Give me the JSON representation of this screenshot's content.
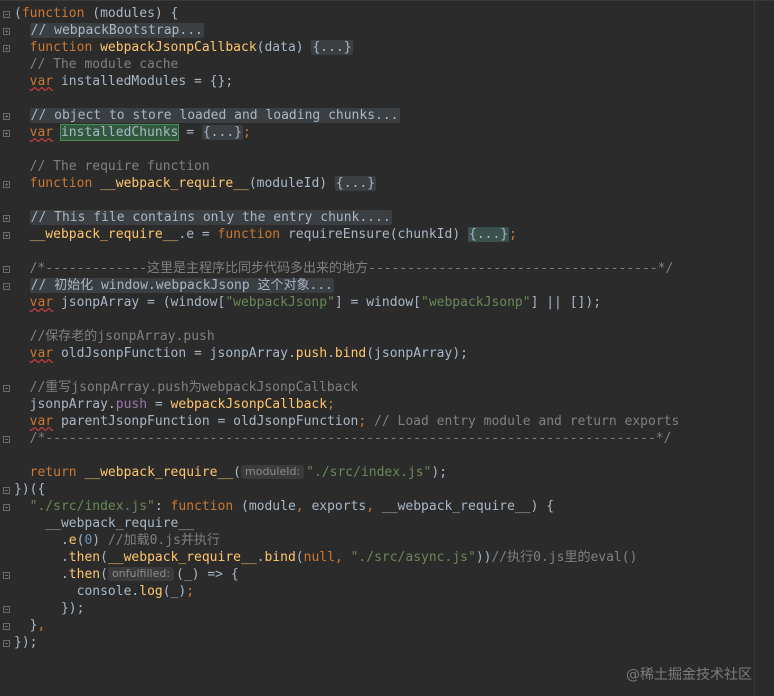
{
  "colors": {
    "background": "#2b2b2b",
    "keyword": "#cc7832",
    "function_name": "#ffc66d",
    "comment": "#808080",
    "string": "#6a8759",
    "number": "#6897bb",
    "property": "#9876aa",
    "plain": "#a9b7c6",
    "selection": "#32593d"
  },
  "editor": {
    "lines": {
      "l1": {
        "a": "(",
        "kw": "function",
        "b": " (modules) {"
      },
      "l2": {
        "comment": "// webpackBootstrap..."
      },
      "l3": {
        "kw": "function",
        "fn": "webpackJsonpCallback",
        "b": "(data) ",
        "fold": "{...}"
      },
      "l4": {
        "comment": "// The module cache"
      },
      "l5": {
        "kw": "var",
        "b": " installedModules = {};"
      },
      "l6": {},
      "l7": {
        "comment": "// object to store loaded and loading chunks..."
      },
      "l8": {
        "kw": "var",
        "sel": "installedChunks",
        "b": " = ",
        "fold": "{...}",
        "c": ";"
      },
      "l9": {},
      "l10": {
        "comment": "// The require function"
      },
      "l11": {
        "kw": "function",
        "fn": "__webpack_require__",
        "b": "(moduleId) ",
        "fold": "{...}"
      },
      "l12": {},
      "l13": {
        "comment": "// This file contains only the entry chunk...."
      },
      "l14": {
        "fn1": "__webpack_require__",
        "b": ".e = ",
        "kw": "function",
        "fn2": " requireEnsure",
        "c": "(chunkId) ",
        "fold": "{...}",
        "d": ";"
      },
      "l15": {},
      "l16": {
        "comment": "/*-------------这里是主程序比同步代码多出来的地方-------------------------------------*/"
      },
      "l17": {
        "comment": "// 初始化 window.webpackJsonp 这个对象..."
      },
      "l18": {
        "kw": "var",
        "b": " jsonpArray = (window[",
        "s1": "\"webpackJsonp\"",
        "c": "] = window[",
        "s2": "\"webpackJsonp\"",
        "d": "] || []);"
      },
      "l19": {},
      "l20": {
        "comment": "//保存老的jsonpArray.push"
      },
      "l21": {
        "kw": "var",
        "b": " oldJsonpFunction = jsonpArray.",
        "fn1": "push",
        "c": ".",
        "fn2": "bind",
        "d": "(jsonpArray);"
      },
      "l22": {},
      "l23": {
        "comment": "//重写jsonpArray.push为webpackJsonpCallback"
      },
      "l24": {
        "b": "jsonpArray.",
        "prop": "push",
        "c": " = ",
        "fn": "webpackJsonpCallback",
        "kw": ";"
      },
      "l25": {
        "kw": "var",
        "b": " parentJsonpFunction = oldJsonpFunction",
        "kw2": ";",
        "comment": " // Load entry module and return exports"
      },
      "l26": {
        "comment": "/*------------------------------------------------------------------------------*/"
      },
      "l27": {},
      "l28": {
        "kw": "return",
        "fn": " __webpack_require__",
        "b": "(",
        "hint": "moduleId:",
        "s": "\"./src/index.js\"",
        "c": ");"
      },
      "l29": {
        "a": "})({"
      },
      "l30": {
        "s": "\"./src/index.js\"",
        "b": ": ",
        "kw": "function",
        "c": " (module",
        "kw2": ",",
        "d": " exports",
        "kw3": ",",
        "e": " __webpack_require__) {"
      },
      "l31": {
        "b": "__webpack_require__"
      },
      "l32": {
        "b": ".",
        "fn": "e",
        "c": "(",
        "num": "0",
        "d": ") ",
        "comment": "//加载0.js并执行"
      },
      "l33": {
        "b": ".",
        "fn": "then",
        "c": "(",
        "fn2": "__webpack_require__",
        "d": ".",
        "fn3": "bind",
        "e": "(",
        "kw": "null",
        "kw2": ",",
        "s": " \"./src/async.js\"",
        "f": "))",
        "comment": "//执行0.js里的eval()"
      },
      "l34": {
        "b": ".",
        "fn": "then",
        "c": "(",
        "hint": "onfulfilled:",
        "d": "(_) => {"
      },
      "l35": {
        "b": "console.",
        "fn": "log",
        "c": "(_)",
        "kw": ";"
      },
      "l36": {
        "b": "});"
      },
      "l37": {
        "b": "}",
        "kw": ","
      },
      "l38": {
        "b": "});"
      }
    }
  },
  "watermark": "@稀土掘金技术社区"
}
